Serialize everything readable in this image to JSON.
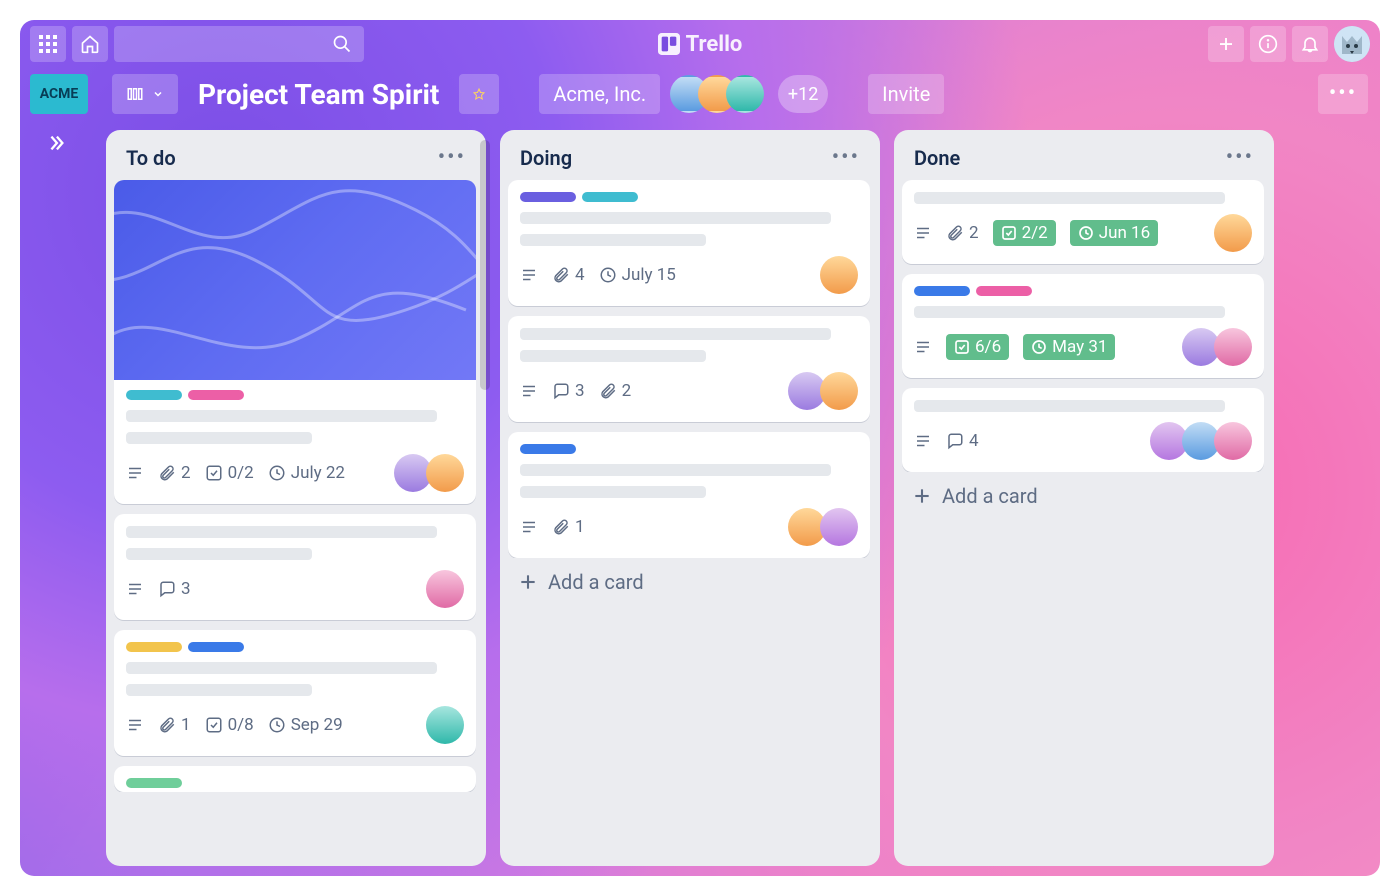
{
  "brand": "Trello",
  "workspace_badge": "ACME",
  "board": {
    "title": "Project Team Spirit",
    "org": "Acme, Inc.",
    "extra_members": "+12",
    "invite_label": "Invite"
  },
  "lists": [
    {
      "title": "To do",
      "cards": [
        {
          "cover": true,
          "labels": [
            "#3fbcd0",
            "#ec5fa6"
          ],
          "badges": {
            "description": true,
            "attachments": "2",
            "checklist": "0/2",
            "date": "July 22"
          },
          "members": [
            "lavender",
            "orange"
          ]
        },
        {
          "labels": [],
          "badges": {
            "description": true,
            "comments": "3"
          },
          "members": [
            "pink"
          ]
        },
        {
          "labels": [
            "#f2c44c",
            "#3a7ae8"
          ],
          "badges": {
            "description": true,
            "attachments": "1",
            "checklist": "0/8",
            "date": "Sep 29"
          },
          "members": [
            "teal"
          ]
        },
        {
          "labels": [
            "#6fce9a"
          ],
          "truncated": true
        }
      ]
    },
    {
      "title": "Doing",
      "add_label": "Add a card",
      "cards": [
        {
          "labels": [
            "#6a5fe0",
            "#3fbcd0"
          ],
          "badges": {
            "description": true,
            "attachments": "4",
            "date": "July 15"
          },
          "members": [
            "orange"
          ]
        },
        {
          "labels": [],
          "badges": {
            "description": true,
            "comments": "3",
            "attachments": "2"
          },
          "members": [
            "lavender",
            "orange"
          ]
        },
        {
          "labels": [
            "#3a7ae8"
          ],
          "badges": {
            "description": true,
            "attachments": "1"
          },
          "members": [
            "orange",
            "purple"
          ]
        }
      ]
    },
    {
      "title": "Done",
      "add_label": "Add a card",
      "cards": [
        {
          "labels": [],
          "badges": {
            "description": true,
            "attachments": "2",
            "checklist_done": "2/2",
            "date_done": "Jun 16"
          },
          "members": [
            "orange"
          ]
        },
        {
          "labels": [
            "#3a7ae8",
            "#ec5fa6"
          ],
          "badges": {
            "description": true,
            "checklist_done": "6/6",
            "date_done": "May 31"
          },
          "members": [
            "lavender",
            "pink"
          ]
        },
        {
          "labels": [],
          "badges": {
            "description": true,
            "comments": "4"
          },
          "members": [
            "purple",
            "blue",
            "pink"
          ]
        }
      ]
    }
  ],
  "avatar_colors": {
    "lavender": [
      "#d8c9f2",
      "#9b7be0"
    ],
    "orange": [
      "#ffd89a",
      "#f29b4a"
    ],
    "pink": [
      "#f8c6de",
      "#e06aa5"
    ],
    "teal": [
      "#a7e6df",
      "#2fb8aa"
    ],
    "purple": [
      "#e2c5f0",
      "#b577e0"
    ],
    "blue": [
      "#c2ddf5",
      "#5a9be0"
    ]
  }
}
